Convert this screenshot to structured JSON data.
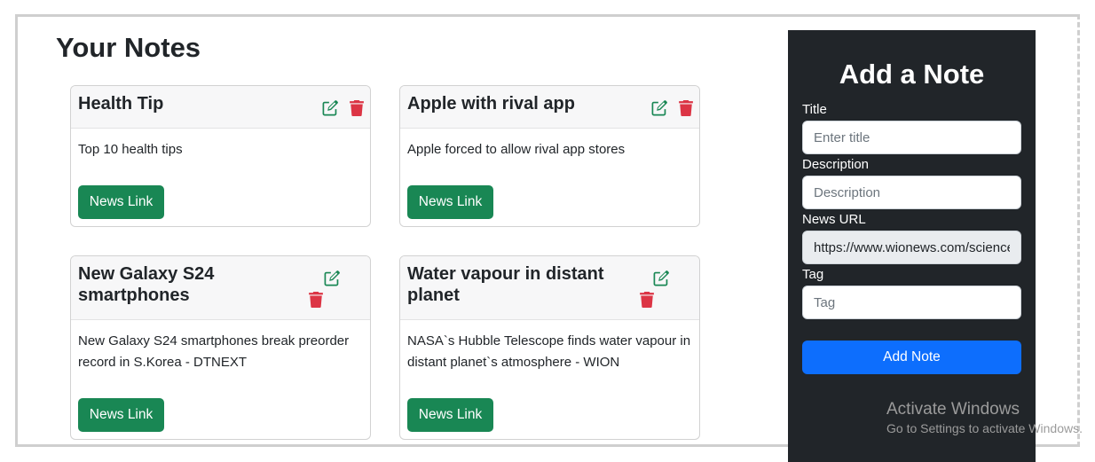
{
  "page": {
    "title": "Your Notes"
  },
  "notes": [
    {
      "title": "Health Tip",
      "description": "Top 10 health tips",
      "link_label": "News Link"
    },
    {
      "title": "Apple with rival app",
      "description": "Apple forced to allow rival app stores",
      "link_label": "News Link"
    },
    {
      "title": "New Galaxy S24 smartphones",
      "description": "New Galaxy S24 smartphones break preorder record in S.Korea - DTNEXT",
      "link_label": "News Link"
    },
    {
      "title": "Water vapour in distant planet",
      "description": "NASA`s Hubble Telescope finds water vapour in distant planet`s atmosphere - WION",
      "link_label": "News Link"
    }
  ],
  "form": {
    "heading": "Add a Note",
    "title_label": "Title",
    "title_placeholder": "Enter title",
    "description_label": "Description",
    "description_placeholder": "Description",
    "url_label": "News URL",
    "url_value": "https://www.wionews.com/science",
    "tag_label": "Tag",
    "tag_placeholder": "Tag",
    "submit_label": "Add Note"
  },
  "watermark": {
    "title": "Activate Windows",
    "subtitle": "Go to Settings to activate Windows."
  },
  "icons": {
    "edit": "edit-icon",
    "delete": "trash-icon"
  },
  "colors": {
    "success": "#198754",
    "danger": "#dc3545",
    "primary": "#0d6efd",
    "sidebar": "#212529"
  }
}
